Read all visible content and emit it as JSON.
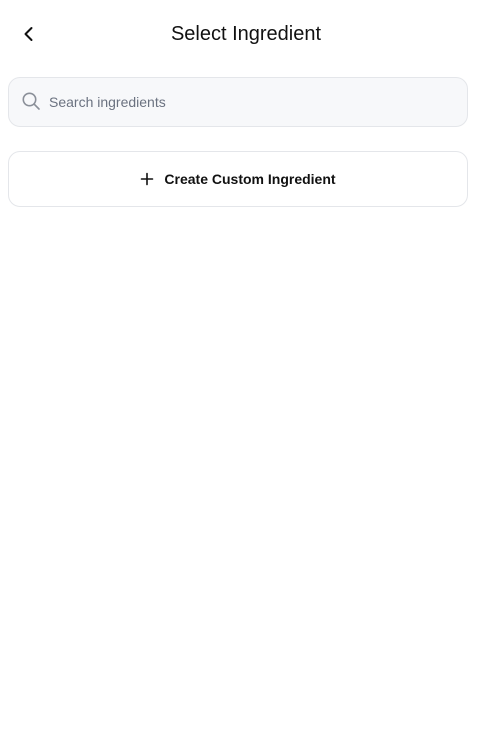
{
  "header": {
    "title": "Select Ingredient",
    "back_icon": "chevron-left-icon"
  },
  "search": {
    "placeholder": "Search ingredients",
    "value": "",
    "icon": "search-icon"
  },
  "actions": {
    "create_label": "Create Custom Ingredient",
    "create_icon": "plus-icon"
  },
  "colors": {
    "background": "#ffffff",
    "search_background": "#f7f8fa",
    "border": "#e4e6ea",
    "text": "#111111",
    "placeholder": "#6b7280"
  }
}
